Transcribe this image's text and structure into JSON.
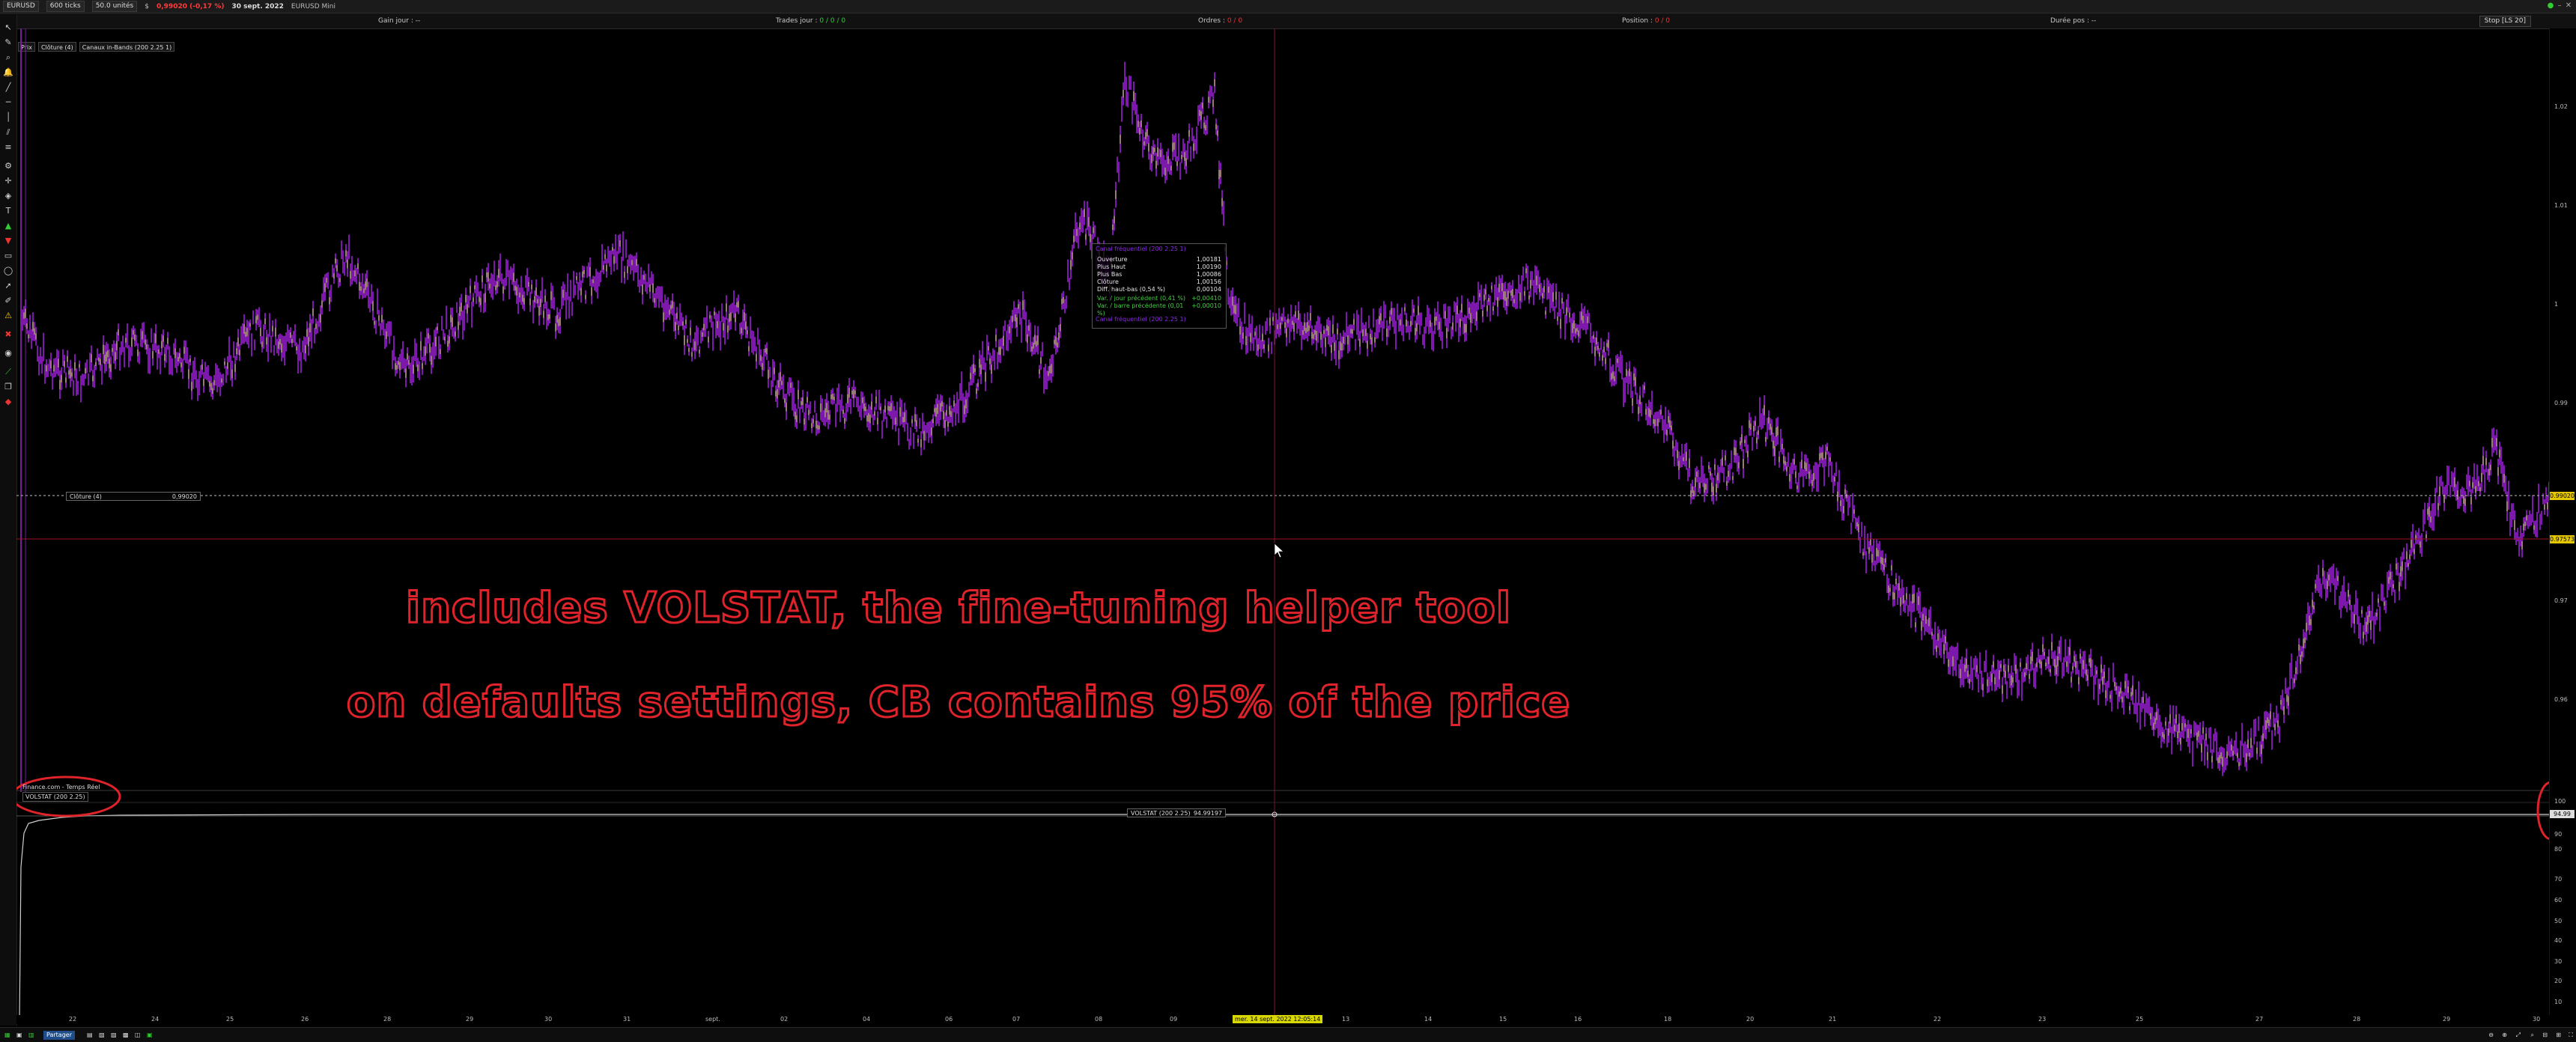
{
  "topbar": {
    "symbol": "EURUSD",
    "ticks": "600 ticks",
    "units": "50.0 unités",
    "dollar": "$",
    "quote": "0,99020 (-0,17 %)",
    "date": "30 sept. 2022",
    "instrument": "EURUSD Mini"
  },
  "statusbar": {
    "gain_label": "Gain jour :",
    "gain_value": "--",
    "trades_label": "Trades jour :",
    "trades_value": "0 / 0 / 0",
    "orders_label": "Ordres :",
    "orders_value": "0 / 0",
    "position_label": "Position :",
    "position_value": "0 / 0",
    "duree_label": "Durée pos :",
    "duree_value": "--",
    "stop_label": "Stop [LS 20]"
  },
  "legend": [
    "Prix",
    "Clôture (4)",
    "Canaux in-Bands (200 2.25 1)"
  ],
  "overlay_text": {
    "line1": "includes VOLSTAT, the fine-tuning helper tool",
    "line2": "on defaults settings, CB contains 95% of the price"
  },
  "infobox": {
    "header_top": "Canal fréquentiel (200 2.25 1)",
    "header_bottom": "Canal fréquentiel (200 2.25 1)",
    "rows": [
      {
        "label": "Ouverture",
        "value": "1,00181"
      },
      {
        "label": "Plus Haut",
        "value": "1,00190"
      },
      {
        "label": "Plus Bas",
        "value": "1,00086"
      },
      {
        "label": "Clôture",
        "value": "1,00156"
      },
      {
        "label": "Diff. haut-bas (0,54 %)",
        "value": "0,00104"
      }
    ],
    "green_rows": [
      {
        "label": "Var. / jour précédent (0,41 %)",
        "value": "+0,00410"
      },
      {
        "label": "Var. / barre précédente (0,01 %)",
        "value": "+0,00010"
      }
    ]
  },
  "cloture_box": {
    "label": "Clôture (4)",
    "value": "0,99020"
  },
  "subpanel": {
    "title": "Finance.com - Temps Réel",
    "indicator": "VOLSTAT (200 2.25)",
    "readout_label": "VOLSTAT (200 2.25)",
    "readout_value": "94.99197"
  },
  "yaxis_main": [
    "1.02",
    "1.01",
    "1",
    "0.99",
    "0.98",
    "0.97",
    "0.96"
  ],
  "price_tags": {
    "close": "0.99020",
    "cursor": "0.97573"
  },
  "yaxis_sub": [
    "100",
    "90",
    "80",
    "70",
    "60",
    "50",
    "40",
    "30",
    "20",
    "10"
  ],
  "sub_tag": "94.99",
  "xaxis": [
    "22",
    "24",
    "25",
    "26",
    "28",
    "29",
    "30",
    "31",
    "sept.",
    "02",
    "04",
    "06",
    "07",
    "08",
    "09",
    "11",
    "13",
    "14",
    "15",
    "16",
    "18",
    "20",
    "21",
    "22",
    "23",
    "25",
    "27",
    "28",
    "29",
    "30"
  ],
  "xaxis_cursor": "mer. 14 sept. 2022 12:05:14",
  "taskbar": {
    "partage": "Partager"
  },
  "colors": {
    "candles": "#9b1fd6",
    "wick_fill": "#d6e36a",
    "overlay_text": "#e0232b",
    "crosshair": "#8a1a2a",
    "cursor_tag": "#d8d800"
  }
}
